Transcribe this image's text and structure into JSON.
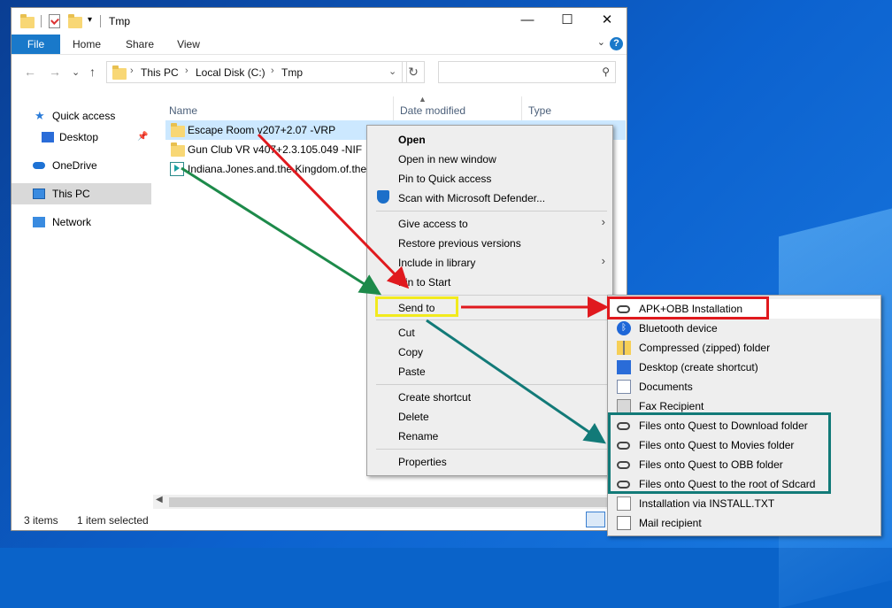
{
  "window": {
    "title": "Tmp"
  },
  "title_controls": {
    "minimize": "—",
    "maximize": "☐",
    "close": "✕"
  },
  "ribbon": {
    "tabs": [
      "File",
      "Home",
      "Share",
      "View"
    ],
    "help": "?"
  },
  "nav": {
    "back": "←",
    "forward": "→",
    "recent": "⌄",
    "up": "↑",
    "refresh": "↻"
  },
  "address": {
    "segments": [
      "This PC",
      "Local Disk (C:)",
      "Tmp"
    ],
    "sep": "›",
    "search_placeholder": ""
  },
  "navpane": {
    "items": [
      {
        "label": "Quick access",
        "icon": "star-icon"
      },
      {
        "label": "Desktop",
        "icon": "desktop-icon",
        "pinned": true
      },
      {
        "label": "OneDrive",
        "icon": "cloud-icon"
      },
      {
        "label": "This PC",
        "icon": "pc-icon",
        "selected": true
      },
      {
        "label": "Network",
        "icon": "network-icon"
      }
    ]
  },
  "columns": [
    "Name",
    "Date modified",
    "Type"
  ],
  "files": [
    {
      "name": "Escape Room v207+2.07 -VRP",
      "icon": "folder-icon",
      "selected": true
    },
    {
      "name": "Gun Club VR v407+2.3.105.049 -NIF",
      "icon": "folder-icon"
    },
    {
      "name": "Indiana.Jones.and.the.Kingdom.of.the.",
      "icon": "media-icon"
    }
  ],
  "status": {
    "items": "3 items",
    "selected": "1 item selected"
  },
  "context_menu": {
    "open": "Open",
    "open_new_window": "Open in new window",
    "pin_quick_access": "Pin to Quick access",
    "scan": "Scan with Microsoft Defender...",
    "give_access": "Give access to",
    "restore": "Restore previous versions",
    "include_library": "Include in library",
    "pin_start": "Pin to Start",
    "send_to": "Send to",
    "cut": "Cut",
    "copy": "Copy",
    "paste": "Paste",
    "create_shortcut": "Create shortcut",
    "delete": "Delete",
    "rename": "Rename",
    "properties": "Properties",
    "chevron": "›"
  },
  "send_to_menu": {
    "items": [
      {
        "label": "APK+OBB Installation",
        "icon": "oval-icon"
      },
      {
        "label": "Bluetooth device",
        "icon": "bluetooth-icon"
      },
      {
        "label": "Compressed (zipped) folder",
        "icon": "zip-folder-icon"
      },
      {
        "label": "Desktop (create shortcut)",
        "icon": "desktop-icon"
      },
      {
        "label": "Documents",
        "icon": "documents-icon"
      },
      {
        "label": "Fax Recipient",
        "icon": "fax-icon"
      },
      {
        "label": "Files onto Quest to Download folder",
        "icon": "oval-icon"
      },
      {
        "label": "Files onto Quest to Movies folder",
        "icon": "oval-icon"
      },
      {
        "label": "Files onto Quest to OBB folder",
        "icon": "oval-icon"
      },
      {
        "label": "Files onto Quest to the root of Sdcard",
        "icon": "oval-icon"
      },
      {
        "label": "Installation via INSTALL.TXT",
        "icon": "text-file-icon"
      },
      {
        "label": "Mail recipient",
        "icon": "mail-icon"
      }
    ]
  },
  "annotation_colors": {
    "red": "#e0191e",
    "green": "#1d8a4a",
    "teal": "#127a78",
    "yellow": "#f2ea1e"
  }
}
